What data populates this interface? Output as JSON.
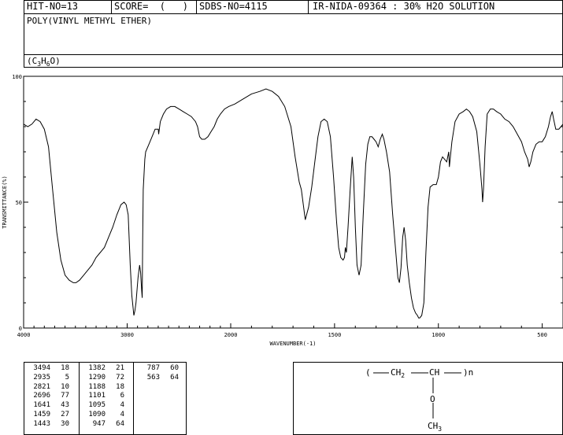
{
  "header": {
    "hit": "HIT-NO=13",
    "score": "SCORE=  (   )",
    "sdbs": "SDBS-NO=4115",
    "ir": "IR-NIDA-09364 : 30% H2O SOLUTION"
  },
  "compound": {
    "name": "POLY(VINYL METHYL ETHER)",
    "formula_open": "(C",
    "formula_c": "3",
    "formula_h": "H",
    "formula_h_sub": "6",
    "formula_o": "O)"
  },
  "chart_data": {
    "type": "line",
    "xlabel": "WAVENUMBER(-1)",
    "ylabel": "TRANSMITTANCE(%)",
    "xlim": [
      4000,
      400
    ],
    "ylim": [
      0,
      100
    ],
    "x_ticks": [
      4000,
      3000,
      2000,
      1500,
      1000,
      500
    ],
    "y_ticks": [
      0,
      50,
      100
    ],
    "grid": false,
    "legend": "none",
    "series": [
      {
        "color": "#000000",
        "points": [
          [
            4000,
            81
          ],
          [
            3960,
            80
          ],
          [
            3920,
            81
          ],
          [
            3880,
            83
          ],
          [
            3840,
            82
          ],
          [
            3800,
            79
          ],
          [
            3760,
            72
          ],
          [
            3720,
            55
          ],
          [
            3680,
            38
          ],
          [
            3640,
            27
          ],
          [
            3600,
            21
          ],
          [
            3560,
            19
          ],
          [
            3520,
            18
          ],
          [
            3494,
            18
          ],
          [
            3460,
            19
          ],
          [
            3420,
            21
          ],
          [
            3380,
            23
          ],
          [
            3340,
            25
          ],
          [
            3300,
            28
          ],
          [
            3260,
            30
          ],
          [
            3220,
            32
          ],
          [
            3180,
            36
          ],
          [
            3140,
            40
          ],
          [
            3100,
            45
          ],
          [
            3060,
            49
          ],
          [
            3030,
            50
          ],
          [
            3010,
            49
          ],
          [
            2990,
            45
          ],
          [
            2970,
            25
          ],
          [
            2955,
            13
          ],
          [
            2945,
            9
          ],
          [
            2935,
            5
          ],
          [
            2925,
            7
          ],
          [
            2915,
            10
          ],
          [
            2905,
            15
          ],
          [
            2895,
            20
          ],
          [
            2880,
            25
          ],
          [
            2870,
            22
          ],
          [
            2860,
            15
          ],
          [
            2855,
            12
          ],
          [
            2850,
            35
          ],
          [
            2845,
            55
          ],
          [
            2830,
            67
          ],
          [
            2821,
            70
          ],
          [
            2790,
            73
          ],
          [
            2760,
            76
          ],
          [
            2730,
            79
          ],
          [
            2700,
            79
          ],
          [
            2696,
            77
          ],
          [
            2680,
            82
          ],
          [
            2650,
            85
          ],
          [
            2620,
            87
          ],
          [
            2580,
            88
          ],
          [
            2540,
            88
          ],
          [
            2500,
            87
          ],
          [
            2460,
            86
          ],
          [
            2420,
            85
          ],
          [
            2380,
            84
          ],
          [
            2340,
            82
          ],
          [
            2320,
            80
          ],
          [
            2300,
            76
          ],
          [
            2280,
            75
          ],
          [
            2250,
            75
          ],
          [
            2220,
            76
          ],
          [
            2190,
            78
          ],
          [
            2160,
            80
          ],
          [
            2130,
            83
          ],
          [
            2100,
            85
          ],
          [
            2060,
            87
          ],
          [
            2020,
            88
          ],
          [
            1980,
            89
          ],
          [
            1940,
            91
          ],
          [
            1900,
            93
          ],
          [
            1860,
            94
          ],
          [
            1830,
            95
          ],
          [
            1800,
            94
          ],
          [
            1770,
            92
          ],
          [
            1740,
            88
          ],
          [
            1710,
            80
          ],
          [
            1690,
            68
          ],
          [
            1670,
            58
          ],
          [
            1660,
            55
          ],
          [
            1641,
            43
          ],
          [
            1625,
            48
          ],
          [
            1610,
            56
          ],
          [
            1595,
            66
          ],
          [
            1580,
            76
          ],
          [
            1565,
            82
          ],
          [
            1550,
            83
          ],
          [
            1535,
            82
          ],
          [
            1520,
            76
          ],
          [
            1505,
            60
          ],
          [
            1490,
            42
          ],
          [
            1480,
            32
          ],
          [
            1470,
            28
          ],
          [
            1459,
            27
          ],
          [
            1452,
            28
          ],
          [
            1448,
            32
          ],
          [
            1443,
            30
          ],
          [
            1435,
            40
          ],
          [
            1425,
            55
          ],
          [
            1415,
            68
          ],
          [
            1408,
            60
          ],
          [
            1400,
            40
          ],
          [
            1392,
            25
          ],
          [
            1382,
            21
          ],
          [
            1372,
            25
          ],
          [
            1362,
            45
          ],
          [
            1350,
            65
          ],
          [
            1340,
            73
          ],
          [
            1330,
            76
          ],
          [
            1320,
            76
          ],
          [
            1310,
            75
          ],
          [
            1300,
            74
          ],
          [
            1290,
            72
          ],
          [
            1280,
            75
          ],
          [
            1270,
            77
          ],
          [
            1262,
            75
          ],
          [
            1250,
            70
          ],
          [
            1235,
            62
          ],
          [
            1220,
            45
          ],
          [
            1205,
            30
          ],
          [
            1195,
            20
          ],
          [
            1188,
            18
          ],
          [
            1180,
            24
          ],
          [
            1172,
            36
          ],
          [
            1165,
            40
          ],
          [
            1158,
            35
          ],
          [
            1150,
            25
          ],
          [
            1140,
            18
          ],
          [
            1130,
            12
          ],
          [
            1120,
            8
          ],
          [
            1110,
            6
          ],
          [
            1101,
            5
          ],
          [
            1095,
            4
          ],
          [
            1090,
            4
          ],
          [
            1080,
            5
          ],
          [
            1070,
            10
          ],
          [
            1060,
            30
          ],
          [
            1050,
            48
          ],
          [
            1040,
            56
          ],
          [
            1025,
            57
          ],
          [
            1010,
            57
          ],
          [
            1000,
            60
          ],
          [
            990,
            66
          ],
          [
            980,
            68
          ],
          [
            970,
            67
          ],
          [
            960,
            66
          ],
          [
            950,
            70
          ],
          [
            947,
            64
          ],
          [
            935,
            74
          ],
          [
            920,
            82
          ],
          [
            900,
            85
          ],
          [
            880,
            86
          ],
          [
            865,
            87
          ],
          [
            850,
            86
          ],
          [
            835,
            84
          ],
          [
            815,
            78
          ],
          [
            800,
            65
          ],
          [
            790,
            55
          ],
          [
            787,
            50
          ],
          [
            783,
            55
          ],
          [
            775,
            72
          ],
          [
            765,
            85
          ],
          [
            750,
            87
          ],
          [
            735,
            87
          ],
          [
            720,
            86
          ],
          [
            700,
            85
          ],
          [
            680,
            83
          ],
          [
            660,
            82
          ],
          [
            640,
            80
          ],
          [
            620,
            77
          ],
          [
            600,
            74
          ],
          [
            585,
            70
          ],
          [
            570,
            67
          ],
          [
            563,
            64
          ],
          [
            555,
            66
          ],
          [
            545,
            70
          ],
          [
            530,
            73
          ],
          [
            515,
            74
          ],
          [
            500,
            74
          ],
          [
            485,
            76
          ],
          [
            470,
            80
          ],
          [
            460,
            84
          ],
          [
            452,
            86
          ],
          [
            445,
            83
          ],
          [
            435,
            79
          ],
          [
            420,
            79
          ],
          [
            410,
            80
          ],
          [
            400,
            81
          ]
        ]
      }
    ]
  },
  "peaks": {
    "col1": [
      [
        "3494",
        "18"
      ],
      [
        "2935",
        "5"
      ],
      [
        "2821",
        "10"
      ],
      [
        "2696",
        "77"
      ],
      [
        "1641",
        "43"
      ],
      [
        "1459",
        "27"
      ],
      [
        "1443",
        "30"
      ]
    ],
    "col2": [
      [
        "1382",
        "21"
      ],
      [
        "1290",
        "72"
      ],
      [
        "1188",
        "18"
      ],
      [
        "1101",
        "6"
      ],
      [
        "1095",
        "4"
      ],
      [
        "1090",
        "4"
      ],
      [
        "947",
        "64"
      ]
    ],
    "col3": [
      [
        "787",
        "60"
      ],
      [
        "563",
        "64"
      ]
    ]
  },
  "structure": {
    "open_paren": "(",
    "ch2": "CH",
    "ch2_sub": "2",
    "ch": "CH",
    "close_n": ")n",
    "o": "O",
    "ch3": "CH",
    "ch3_sub": "3"
  }
}
